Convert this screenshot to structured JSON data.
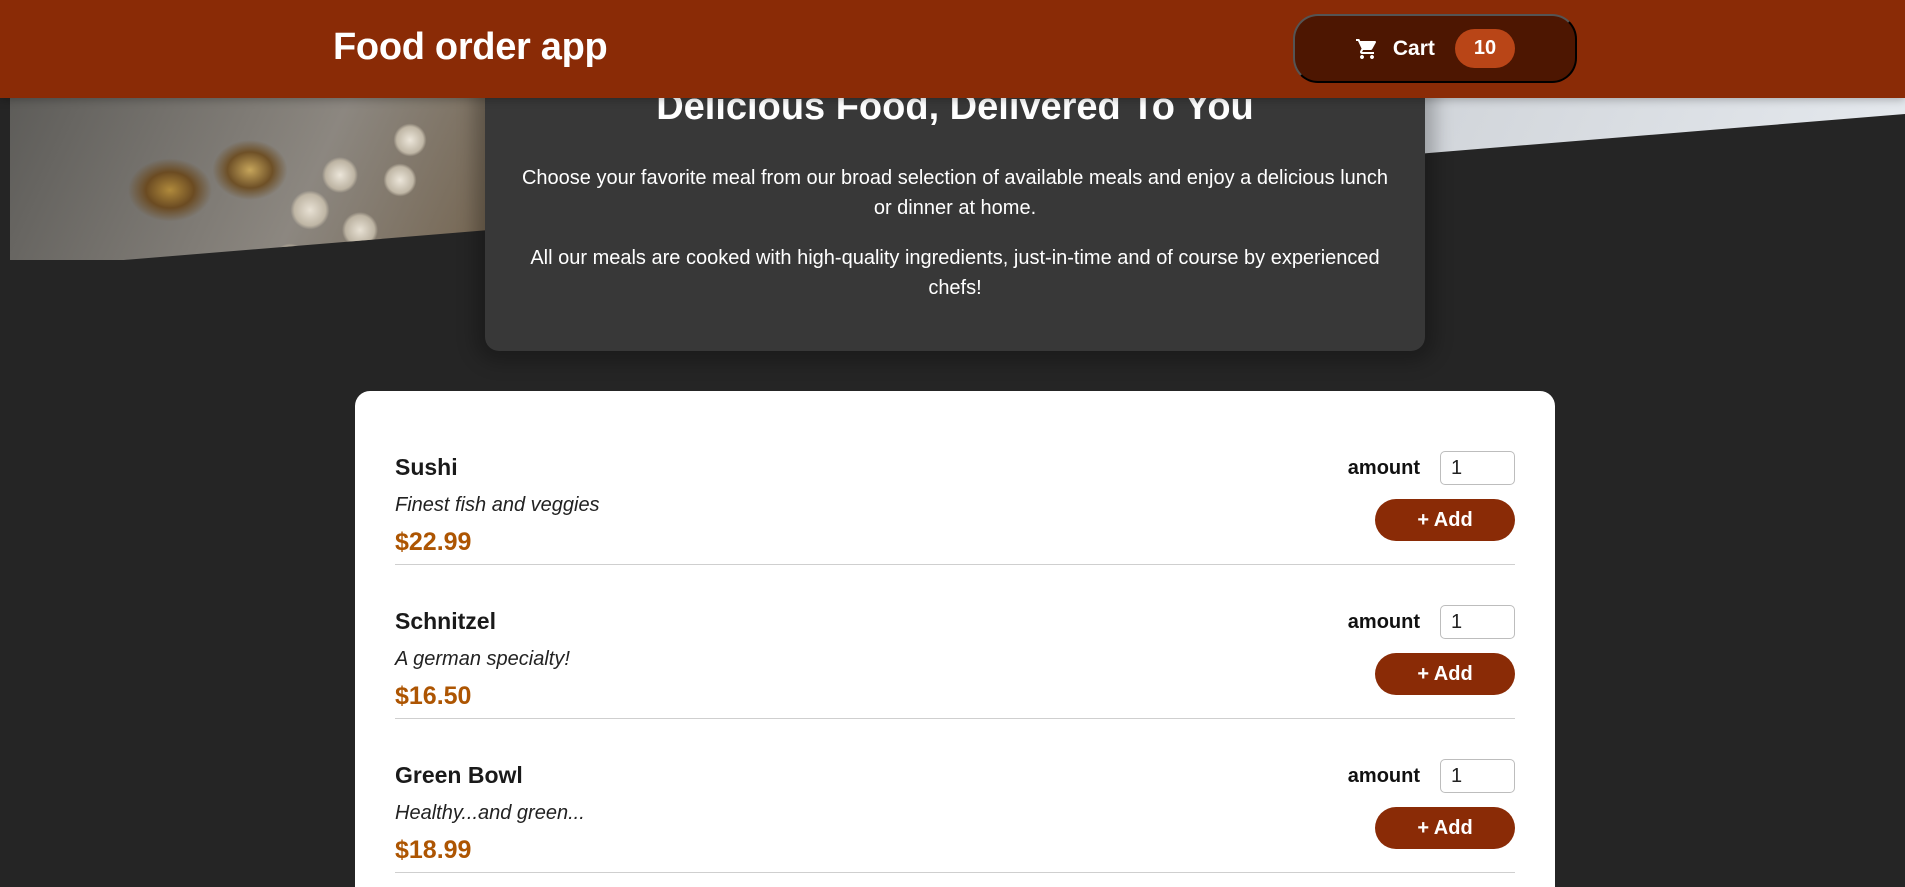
{
  "header": {
    "title": "Food order app",
    "cart_label": "Cart",
    "cart_count": "10"
  },
  "summary": {
    "heading": "Delicious Food, Delivered To You",
    "paragraph1": "Choose your favorite meal from our broad selection of available meals and enjoy a delicious lunch or dinner at home.",
    "paragraph2": "All our meals are cooked with high-quality ingredients, just-in-time and of course by experienced chefs!"
  },
  "meals": [
    {
      "name": "Sushi",
      "description": "Finest fish and veggies",
      "price": "$22.99",
      "amount_label": "amount",
      "amount_value": "1",
      "add_label": "+ Add"
    },
    {
      "name": "Schnitzel",
      "description": "A german specialty!",
      "price": "$16.50",
      "amount_label": "amount",
      "amount_value": "1",
      "add_label": "+ Add"
    },
    {
      "name": "Green Bowl",
      "description": "Healthy...and green...",
      "price": "$18.99",
      "amount_label": "amount",
      "amount_value": "1",
      "add_label": "+ Add"
    }
  ],
  "colors": {
    "header_bg": "#8a2b06",
    "cart_button_bg": "#4d1601",
    "cart_badge_bg": "#b94517",
    "page_bg": "#252525",
    "summary_bg": "#383838",
    "price": "#ad5502"
  },
  "icons": {
    "cart": "shopping-cart-icon"
  }
}
